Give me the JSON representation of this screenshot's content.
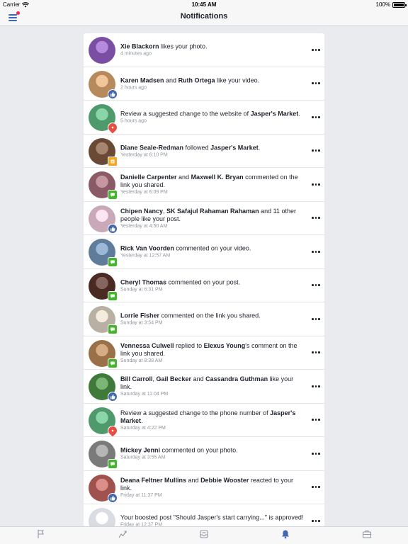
{
  "status_bar": {
    "carrier": "Carrier",
    "time": "10:45 AM",
    "battery": "100%"
  },
  "nav": {
    "title": "Notifications"
  },
  "colors": {
    "accent": "#4267b2",
    "badge_red": "#f02849",
    "comment_green": "#42b72a",
    "page_red": "#e84e43"
  },
  "notifications": [
    {
      "parts": [
        [
          "b",
          "Xie Blackorn"
        ],
        [
          "t",
          " likes your photo."
        ]
      ],
      "time": "4 minutes ago",
      "badge": "none",
      "avatar": "#7a4fa3"
    },
    {
      "parts": [
        [
          "b",
          "Karen Madsen"
        ],
        [
          "t",
          " and "
        ],
        [
          "b",
          "Ruth Ortega"
        ],
        [
          "t",
          " like your video."
        ]
      ],
      "time": "2 hours ago",
      "badge": "like",
      "avatar": "#b68a5c"
    },
    {
      "parts": [
        [
          "t",
          "Review a suggested change to the website of "
        ],
        [
          "b",
          "Jasper's Market"
        ],
        [
          "t",
          "."
        ]
      ],
      "time": "5 hours ago",
      "badge": "page",
      "avatar": "#4e9a6d"
    },
    {
      "parts": [
        [
          "b",
          "Diane Seale-Redman"
        ],
        [
          "t",
          " followed "
        ],
        [
          "b",
          "Jasper's Market"
        ],
        [
          "t",
          "."
        ]
      ],
      "time": "Yesterday at 6:10 PM",
      "badge": "follow",
      "avatar": "#6b4a35"
    },
    {
      "parts": [
        [
          "b",
          "Danielle Carpenter"
        ],
        [
          "t",
          " and "
        ],
        [
          "b",
          "Maxwell K. Bryan"
        ],
        [
          "t",
          " commented on the link you shared."
        ]
      ],
      "time": "Yesterday at 6:09 PM",
      "badge": "comment",
      "avatar": "#8a5a66"
    },
    {
      "parts": [
        [
          "b",
          "Chipen Nancy"
        ],
        [
          "t",
          ", "
        ],
        [
          "b",
          "SK Safajul Rahaman Rahaman"
        ],
        [
          "t",
          " and 11 other people like your post."
        ]
      ],
      "time": "Yesterday at 4:50 AM",
      "badge": "like",
      "avatar": "#c9a9b8"
    },
    {
      "parts": [
        [
          "b",
          "Rick Van Voorden"
        ],
        [
          "t",
          " commented on your video."
        ]
      ],
      "time": "Yesterday at 12:57 AM",
      "badge": "comment",
      "avatar": "#5f7c9a"
    },
    {
      "parts": [
        [
          "b",
          "Cheryl Thomas"
        ],
        [
          "t",
          " commented on your post."
        ]
      ],
      "time": "Sunday at 6:31 PM",
      "badge": "comment",
      "avatar": "#4a2a22"
    },
    {
      "parts": [
        [
          "b",
          "Lorrie Fisher"
        ],
        [
          "t",
          " commented on the link you shared."
        ]
      ],
      "time": "Sunday at 3:54 PM",
      "badge": "comment",
      "avatar": "#b8b0a2"
    },
    {
      "parts": [
        [
          "b",
          "Vennessa Culwell"
        ],
        [
          "t",
          " replied to "
        ],
        [
          "b",
          "Elexus Young"
        ],
        [
          "t",
          "'s comment on the link you shared."
        ]
      ],
      "time": "Sunday at 8:38 AM",
      "badge": "comment",
      "avatar": "#9a7048"
    },
    {
      "parts": [
        [
          "b",
          "Bill Carroll"
        ],
        [
          "t",
          ", "
        ],
        [
          "b",
          "Gail Becker"
        ],
        [
          "t",
          " and "
        ],
        [
          "b",
          "Cassandra Guthman"
        ],
        [
          "t",
          " like your link."
        ]
      ],
      "time": "Saturday at 11:04 PM",
      "badge": "like",
      "avatar": "#3f7a3a"
    },
    {
      "parts": [
        [
          "t",
          "Review a suggested change to the phone number of "
        ],
        [
          "b",
          "Jasper's Market"
        ],
        [
          "t",
          "."
        ]
      ],
      "time": "Saturday at 4:22 PM",
      "badge": "page",
      "avatar": "#4e9a6d"
    },
    {
      "parts": [
        [
          "b",
          "Mickey Jenni"
        ],
        [
          "t",
          " commented on your photo."
        ]
      ],
      "time": "Saturday at 3:55 AM",
      "badge": "comment",
      "avatar": "#7a7a7a"
    },
    {
      "parts": [
        [
          "b",
          "Deana Feltner Mullins"
        ],
        [
          "t",
          " and "
        ],
        [
          "b",
          "Debbie Wooster"
        ],
        [
          "t",
          " reacted to your link."
        ]
      ],
      "time": "Friday at 11:37 PM",
      "badge": "like",
      "avatar": "#a0524e"
    },
    {
      "parts": [
        [
          "t",
          "Your boosted post \"Should Jasper's start carrying...\" is approved!"
        ]
      ],
      "time": "Friday at 12:37 PM",
      "badge": "none",
      "avatar": "#d9dde3"
    }
  ],
  "tabs": [
    {
      "icon": "flag-icon",
      "active": false
    },
    {
      "icon": "insights-icon",
      "active": false
    },
    {
      "icon": "inbox-icon",
      "active": false
    },
    {
      "icon": "bell-icon",
      "active": true
    },
    {
      "icon": "briefcase-icon",
      "active": false
    }
  ]
}
